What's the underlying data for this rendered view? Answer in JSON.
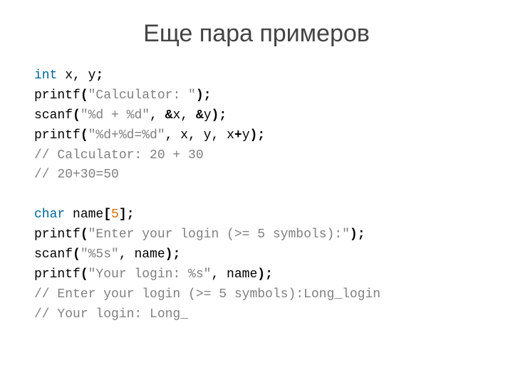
{
  "title": "Еще пара примеров",
  "code": {
    "l1": {
      "kw": "int",
      "rest": " x, y",
      "semi": ";"
    },
    "l2": {
      "fn": "printf",
      "lp": "(",
      "str": "\"Calculator: \"",
      "rp": ");"
    },
    "l3": {
      "fn": "scanf",
      "lp": "(",
      "str": "\"%d + %d\"",
      "c1": ", ",
      "amp1": "&",
      "v1": "x",
      "c2": ", ",
      "amp2": "&",
      "v2": "y",
      "rp": ");"
    },
    "l4": {
      "fn": "printf",
      "lp": "(",
      "str": "\"%d+%d=%d\"",
      "args": ", x, y, x",
      "plus": "+",
      "argy": "y",
      "rp": ");"
    },
    "l5": {
      "cmt": "// Calculator: 20 + 30"
    },
    "l6": {
      "cmt": "// 20+30=50"
    },
    "l8": {
      "kw": "char",
      "sp": " name",
      "lb": "[",
      "num": "5",
      "rb": "];"
    },
    "l9": {
      "fn": "printf",
      "lp": "(",
      "str": "\"Enter your login (>= 5 symbols):\"",
      "rp": ");"
    },
    "l10": {
      "fn": "scanf",
      "lp": "(",
      "str": "\"%5s\"",
      "args": ", name",
      "rp": ");"
    },
    "l11": {
      "fn": "printf",
      "lp": "(",
      "str": "\"Your login: %s\"",
      "args": ", name",
      "rp": ");"
    },
    "l12": {
      "cmt": "// Enter your login (>= 5 symbols):Long_login"
    },
    "l13": {
      "cmt": "// Your login: Long_"
    }
  }
}
